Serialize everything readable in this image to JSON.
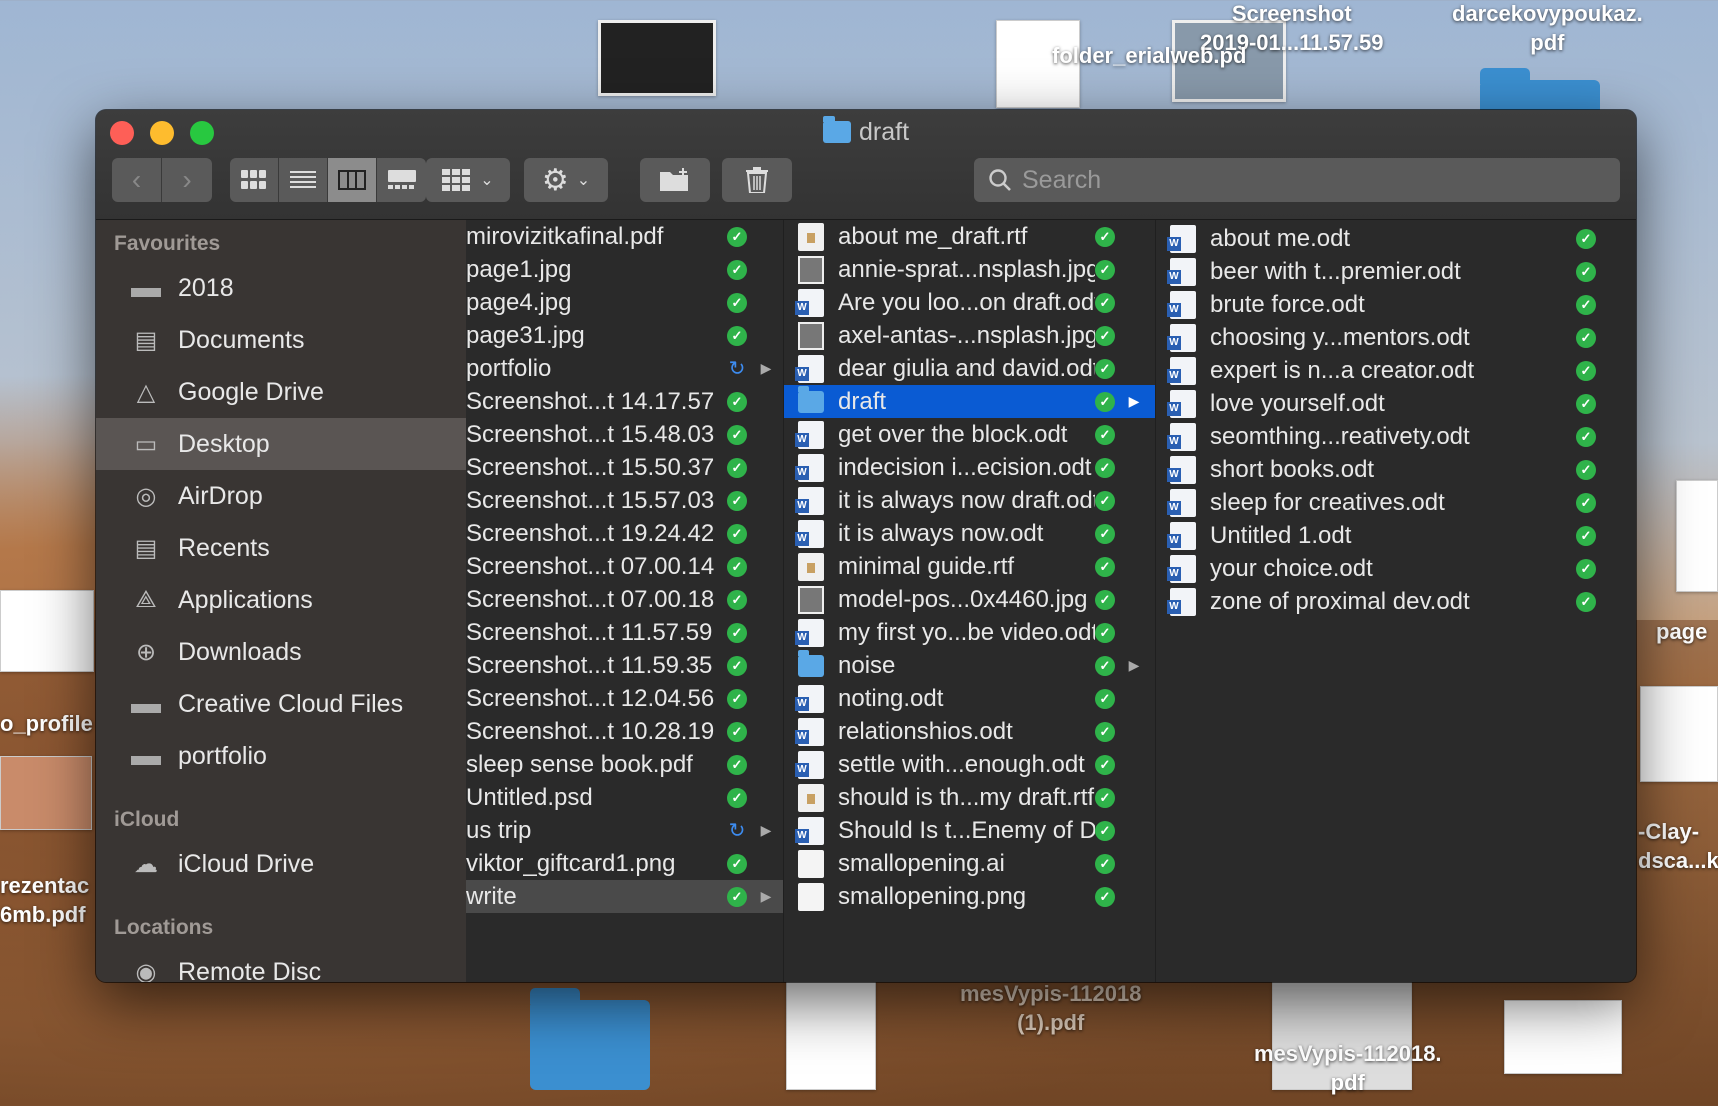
{
  "window": {
    "title": "draft",
    "search_placeholder": "Search"
  },
  "toolbar": {
    "back_icon": "chevron-left-icon",
    "forward_icon": "chevron-right-icon",
    "views": [
      "icon-view",
      "list-view",
      "column-view",
      "gallery-view"
    ],
    "active_view": "column-view"
  },
  "desktop": {
    "labels": [
      "Screenshot\n2019-01...11.57.59",
      "darcekovypoukaz.\npdf",
      "folder_erialweb.pd",
      "mesVypis-112018\n(1).pdf",
      "mesVypis-112018.\npdf",
      "o_profile",
      "rezentac\n6mb.pdf",
      "page",
      "-Clay-\ndsca...k"
    ]
  },
  "sidebar": {
    "sections": [
      {
        "title": "Favourites",
        "items": [
          {
            "label": "2018",
            "icon": "folder-icon"
          },
          {
            "label": "Documents",
            "icon": "documents-icon"
          },
          {
            "label": "Google Drive",
            "icon": "google-drive-icon"
          },
          {
            "label": "Desktop",
            "icon": "desktop-icon",
            "active": true
          },
          {
            "label": "AirDrop",
            "icon": "airdrop-icon"
          },
          {
            "label": "Recents",
            "icon": "recents-icon"
          },
          {
            "label": "Applications",
            "icon": "applications-icon"
          },
          {
            "label": "Downloads",
            "icon": "downloads-icon"
          },
          {
            "label": "Creative Cloud Files",
            "icon": "folder-icon"
          },
          {
            "label": "portfolio",
            "icon": "folder-icon"
          }
        ]
      },
      {
        "title": "iCloud",
        "items": [
          {
            "label": "iCloud Drive",
            "icon": "icloud-icon"
          }
        ]
      },
      {
        "title": "Locations",
        "items": [
          {
            "label": "Remote Disc",
            "icon": "disc-icon"
          }
        ]
      }
    ]
  },
  "columns": [
    {
      "items": [
        {
          "name": "mirovizitkafinal.pdf",
          "status": "synced"
        },
        {
          "name": "page1.jpg",
          "status": "synced"
        },
        {
          "name": "page4.jpg",
          "status": "synced"
        },
        {
          "name": "page31.jpg",
          "status": "synced"
        },
        {
          "name": "portfolio",
          "status": "syncing",
          "folder": true
        },
        {
          "name": "Screenshot...t 14.17.57",
          "status": "synced"
        },
        {
          "name": "Screenshot...t 15.48.03",
          "status": "synced"
        },
        {
          "name": "Screenshot...t 15.50.37",
          "status": "synced"
        },
        {
          "name": "Screenshot...t 15.57.03",
          "status": "synced"
        },
        {
          "name": "Screenshot...t 19.24.42",
          "status": "synced"
        },
        {
          "name": "Screenshot...t 07.00.14",
          "status": "synced"
        },
        {
          "name": "Screenshot...t 07.00.18",
          "status": "synced"
        },
        {
          "name": "Screenshot...t 11.57.59",
          "status": "synced"
        },
        {
          "name": "Screenshot...t 11.59.35",
          "status": "synced"
        },
        {
          "name": "Screenshot...t 12.04.56",
          "status": "synced"
        },
        {
          "name": "Screenshot...t 10.28.19",
          "status": "synced"
        },
        {
          "name": "sleep sense book.pdf",
          "status": "synced"
        },
        {
          "name": "Untitled.psd",
          "status": "synced"
        },
        {
          "name": "us trip",
          "status": "syncing",
          "folder": true
        },
        {
          "name": "viktor_giftcard1.png",
          "status": "synced"
        },
        {
          "name": "write",
          "status": "synced",
          "folder": true,
          "selected": "gray"
        }
      ]
    },
    {
      "items": [
        {
          "name": "about me_draft.rtf",
          "type": "rtf"
        },
        {
          "name": "annie-sprat...nsplash.jpg",
          "type": "img"
        },
        {
          "name": "Are you loo...on draft.odt",
          "type": "doc"
        },
        {
          "name": "axel-antas-...nsplash.jpg",
          "type": "img"
        },
        {
          "name": "dear giulia and david.odt",
          "type": "doc"
        },
        {
          "name": "draft",
          "type": "fold",
          "folder": true,
          "selected": "blue"
        },
        {
          "name": "get over the block.odt",
          "type": "doc"
        },
        {
          "name": "indecision i...ecision.odt",
          "type": "doc"
        },
        {
          "name": "it is always now draft.odt",
          "type": "doc"
        },
        {
          "name": "it is always now.odt",
          "type": "doc"
        },
        {
          "name": "minimal guide.rtf",
          "type": "rtf"
        },
        {
          "name": "model-pos...0x4460.jpg",
          "type": "img"
        },
        {
          "name": "my first yo...be video.odt",
          "type": "doc"
        },
        {
          "name": "noise",
          "type": "fold",
          "folder": true
        },
        {
          "name": "noting.odt",
          "type": "doc"
        },
        {
          "name": "relationshios.odt",
          "type": "doc"
        },
        {
          "name": "settle with...enough.odt",
          "type": "doc"
        },
        {
          "name": "should is th...my draft.rtf",
          "type": "rtf"
        },
        {
          "name": "Should Is t...Enemy of Do",
          "type": "doc"
        },
        {
          "name": "smallopening.ai",
          "type": "ai"
        },
        {
          "name": "smallopening.png",
          "type": "ai"
        }
      ]
    },
    {
      "items": [
        {
          "name": "about me.odt",
          "type": "doc"
        },
        {
          "name": "beer with t...premier.odt",
          "type": "doc"
        },
        {
          "name": "brute force.odt",
          "type": "doc"
        },
        {
          "name": "choosing y...mentors.odt",
          "type": "doc"
        },
        {
          "name": "expert is n...a creator.odt",
          "type": "doc"
        },
        {
          "name": "love yourself.odt",
          "type": "doc"
        },
        {
          "name": "seomthing...reativety.odt",
          "type": "doc"
        },
        {
          "name": "short books.odt",
          "type": "doc"
        },
        {
          "name": "sleep for creatives.odt",
          "type": "doc"
        },
        {
          "name": "Untitled 1.odt",
          "type": "doc"
        },
        {
          "name": "your choice.odt",
          "type": "doc"
        },
        {
          "name": "zone of proximal dev.odt",
          "type": "doc"
        }
      ]
    }
  ]
}
